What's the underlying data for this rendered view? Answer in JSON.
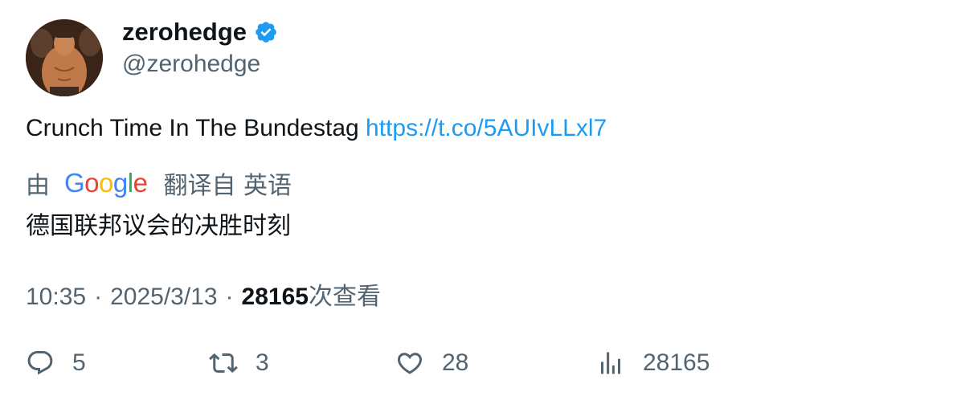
{
  "author": {
    "display_name": "zerohedge",
    "handle": "@zerohedge",
    "verified_icon": "verified-badge-icon",
    "verified_color": "#1d9bf0"
  },
  "tweet": {
    "text": "Crunch Time In The Bundestag",
    "link": "https://t.co/5AUIvLLxl7"
  },
  "translation": {
    "prefix": "由",
    "provider": "Google",
    "suffix": "翻译自 英语",
    "text": "德国联邦议会的决胜时刻"
  },
  "meta": {
    "time": "10:35",
    "separator": "·",
    "date": "2025/3/13",
    "views_count": "28165",
    "views_label": "次查看"
  },
  "actions": {
    "replies": "5",
    "retweets": "3",
    "likes": "28",
    "views": "28165"
  },
  "colors": {
    "text_primary": "#0f1419",
    "text_secondary": "#536471",
    "link": "#1d9bf0"
  }
}
